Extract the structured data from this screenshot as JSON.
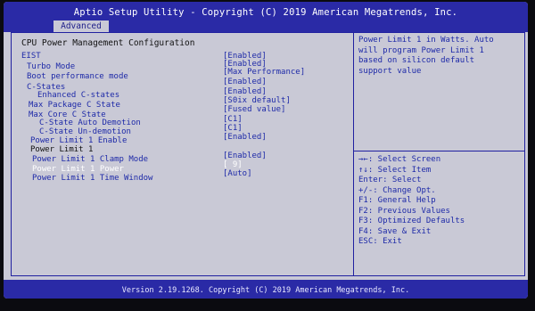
{
  "header": {
    "title": "Aptio Setup Utility - Copyright (C) 2019 American Megatrends, Inc.",
    "tab": "Advanced"
  },
  "section": {
    "heading": "CPU Power Management Configuration"
  },
  "items": [
    {
      "label": "EIST",
      "value": "[Enabled]"
    },
    {
      "label": "Turbo Mode",
      "value": "[Enabled]"
    },
    {
      "label": "Boot performance mode",
      "value": "[Max Performance]"
    },
    {
      "label": "C-States",
      "value": "[Enabled]"
    },
    {
      "label": "Enhanced C-states",
      "value": "[Enabled]"
    },
    {
      "label": "Max Package C State",
      "value": "[S0ix default]"
    },
    {
      "label": "Max Core C State",
      "value": "[Fused value]"
    },
    {
      "label": "C-State Auto Demotion",
      "value": "[C1]"
    },
    {
      "label": "C-State Un-demotion",
      "value": "[C1]"
    },
    {
      "label": "Power Limit 1 Enable",
      "value": "[Enabled]"
    },
    {
      "label": "Power Limit 1",
      "value": ""
    },
    {
      "label": "Power Limit 1 Clamp Mode",
      "value": "[Enabled]"
    },
    {
      "label": "Power Limit 1 Power",
      "value": "[ 9]"
    },
    {
      "label": "Power Limit 1 Time Window",
      "value": "[Auto]"
    }
  ],
  "help_text": "Power Limit 1 in Watts. Auto\nwill program Power Limit 1\nbased on silicon default\nsupport value",
  "keys": [
    "→←: Select Screen",
    "↑↓: Select Item",
    "Enter: Select",
    "+/-: Change Opt.",
    "F1: General Help",
    "F2: Previous Values",
    "F3: Optimized Defaults",
    "F4: Save & Exit",
    "ESC: Exit"
  ],
  "footer": "Version 2.19.1268. Copyright (C) 2019 American Megatrends, Inc."
}
